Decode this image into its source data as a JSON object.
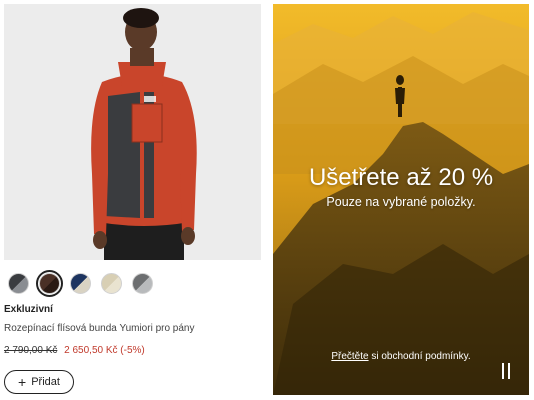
{
  "product": {
    "image_alt": "Rozepínací flísová bunda Yumiori pro pány",
    "swatches": [
      {
        "name": "black-grey",
        "color": "#3a3c40",
        "accent": "#8a8d92"
      },
      {
        "name": "brown",
        "color": "#4a3026",
        "accent": "#2a1a14",
        "selected": true
      },
      {
        "name": "navy",
        "color": "#1d3460",
        "accent": "#d9d3c3"
      },
      {
        "name": "cream",
        "color": "#d8cfb4",
        "accent": "#e9e3d0"
      },
      {
        "name": "grey",
        "color": "#6c6e70",
        "accent": "#b8babc"
      }
    ],
    "badge": "Exkluzivní",
    "name": "Rozepínací flísová bunda Yumiori pro pány",
    "price_old": "2 790,00 Kč",
    "price_new": "2 650,50 Kč (-5%)",
    "add_icon": "plus-icon",
    "add_label": "Přidat"
  },
  "promo": {
    "headline": "Ušetřete až 20 %",
    "subtitle": "Pouze na vybrané položky.",
    "terms_link": "Přečtěte",
    "terms_rest": " si obchodní podmínky.",
    "pause_icon": "pause-icon",
    "tint_color": "#e3a51a"
  }
}
